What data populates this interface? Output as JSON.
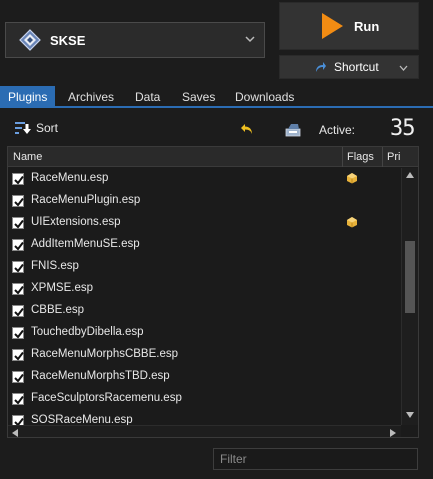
{
  "executable": {
    "name": "SKSE",
    "icon": "skse-diamond-icon"
  },
  "run": {
    "label": "Run",
    "icon": "play-icon"
  },
  "shortcut": {
    "label": "Shortcut",
    "icon": "shortcut-arrow-icon"
  },
  "tabs": [
    {
      "label": "Plugins",
      "active": true
    },
    {
      "label": "Archives",
      "active": false
    },
    {
      "label": "Data",
      "active": false
    },
    {
      "label": "Saves",
      "active": false
    },
    {
      "label": "Downloads",
      "active": false
    }
  ],
  "toolbar": {
    "sort_label": "Sort",
    "active_label": "Active:",
    "active_count": "35"
  },
  "plugin_list": {
    "columns": [
      "Name",
      "Flags",
      "Priority"
    ],
    "visible_priority_header": "Pri",
    "items": [
      {
        "name": "RaceMenu.esp",
        "checked": true,
        "flag": "archive"
      },
      {
        "name": "RaceMenuPlugin.esp",
        "checked": true,
        "flag": ""
      },
      {
        "name": "UIExtensions.esp",
        "checked": true,
        "flag": "archive"
      },
      {
        "name": "AddItemMenuSE.esp",
        "checked": true,
        "flag": ""
      },
      {
        "name": "FNIS.esp",
        "checked": true,
        "flag": ""
      },
      {
        "name": "XPMSE.esp",
        "checked": true,
        "flag": ""
      },
      {
        "name": "CBBE.esp",
        "checked": true,
        "flag": ""
      },
      {
        "name": "TouchedbyDibella.esp",
        "checked": true,
        "flag": ""
      },
      {
        "name": "RaceMenuMorphsCBBE.esp",
        "checked": true,
        "flag": ""
      },
      {
        "name": "RaceMenuMorphsTBD.esp",
        "checked": true,
        "flag": ""
      },
      {
        "name": "FaceSculptorsRacemenu.esp",
        "checked": true,
        "flag": ""
      },
      {
        "name": "SOSRaceMenu.esp",
        "checked": true,
        "flag": ""
      }
    ]
  },
  "filter": {
    "placeholder": "Filter",
    "value": ""
  },
  "colors": {
    "accent": "#2b6cb3",
    "run_icon": "#f28c13",
    "flag_icon": "#e8b23a"
  }
}
